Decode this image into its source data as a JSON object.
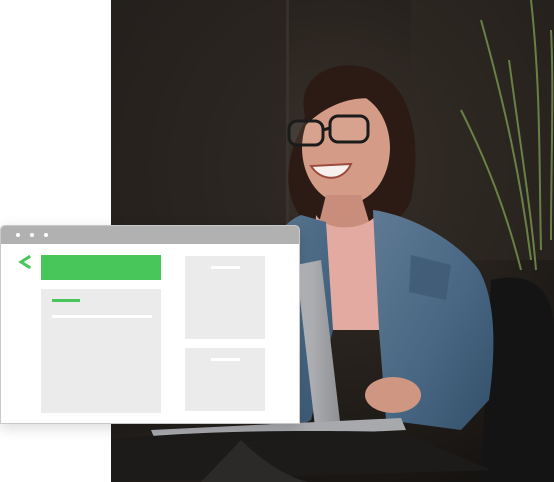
{
  "photo": {
    "subject": "woman-with-laptop"
  },
  "mock_window": {
    "accent_color": "#48c65a",
    "chrome_color": "#b1b1b1",
    "placeholder_color": "#ebebeb",
    "icons": [
      "window-dot-icon",
      "window-dot-icon",
      "window-dot-icon",
      "chevron-left-icon"
    ]
  }
}
